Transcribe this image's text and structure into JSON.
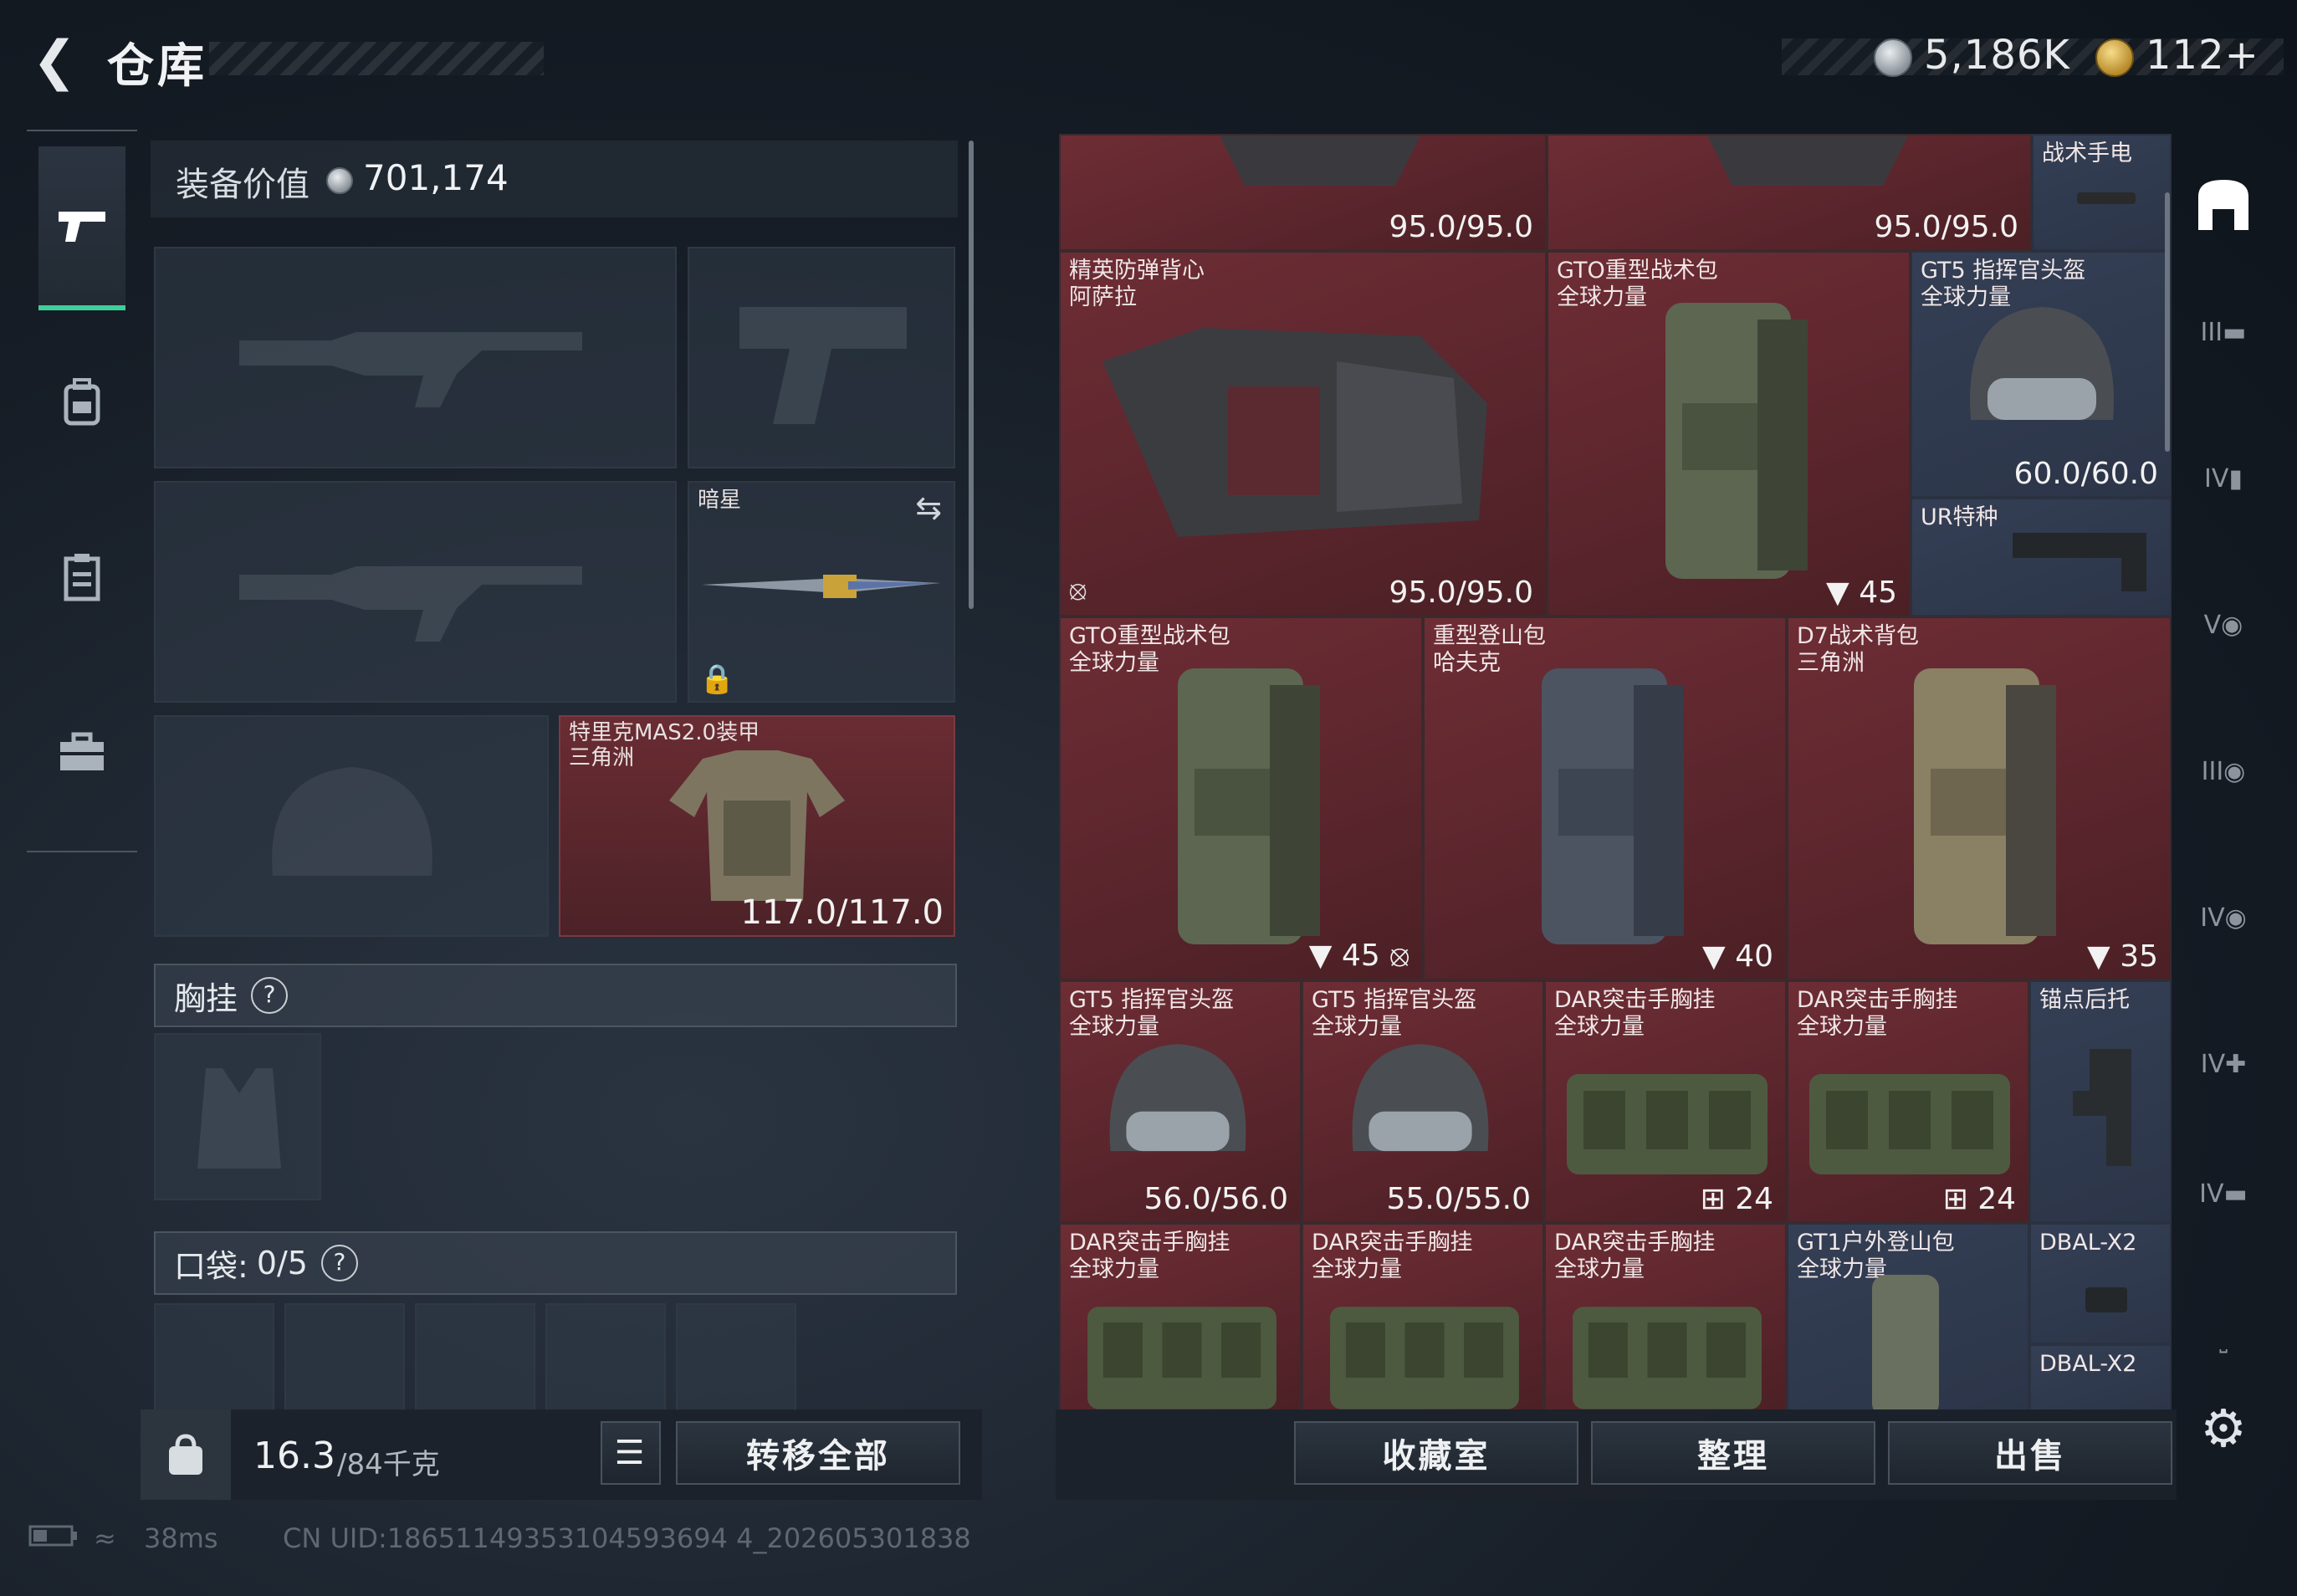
{
  "header": {
    "title": "仓库",
    "currency_silver": "5,186K",
    "currency_gold": "112+"
  },
  "equipment": {
    "value_label": "装备价值",
    "value": "701,174",
    "melee_name": "暗星",
    "armor_name": "特里克MAS2.0装甲",
    "armor_origin": "三角洲",
    "armor_durability": "117.0/117.0",
    "chest_rig_label": "胸挂",
    "chest_rig_help": "?",
    "pockets_label": "口袋:",
    "pockets_count": "0/5",
    "pockets_help": "?",
    "weight_current": "16.3",
    "weight_max": "/84千克",
    "transfer_all": "转移全部"
  },
  "grid": {
    "row0": [
      {
        "dur": "95.0/95.0"
      },
      {
        "dur": "95.0/95.0"
      },
      {
        "name": "战术手电"
      }
    ],
    "items": {
      "vest": {
        "name": "精英防弹背心",
        "sub": "阿萨拉",
        "dur": "95.0/95.0"
      },
      "pack1": {
        "name": "GTO重型战术包",
        "sub": "全球力量",
        "cap": "45"
      },
      "helmet1": {
        "name": "GT5 指挥官头盔",
        "sub": "全球力量",
        "dur": "60.0/60.0"
      },
      "stock1": {
        "name": "UR特种"
      },
      "pack2": {
        "name": "GTO重型战术包",
        "sub": "全球力量",
        "cap": "45"
      },
      "pack3": {
        "name": "重型登山包",
        "sub": "哈夫克",
        "cap": "40"
      },
      "pack4": {
        "name": "D7战术背包",
        "sub": "三角洲",
        "cap": "35"
      },
      "helmet2": {
        "name": "GT5 指挥官头盔",
        "sub": "全球力量",
        "dur": "56.0/56.0"
      },
      "helmet3": {
        "name": "GT5 指挥官头盔",
        "sub": "全球力量",
        "dur": "55.0/55.0"
      },
      "rig1": {
        "name": "DAR突击手胸挂",
        "sub": "全球力量",
        "cap": "24"
      },
      "rig2": {
        "name": "DAR突击手胸挂",
        "sub": "全球力量",
        "cap": "24"
      },
      "stock2": {
        "name": "锚点后托"
      },
      "rig3": {
        "name": "DAR突击手胸挂",
        "sub": "全球力量"
      },
      "rig4": {
        "name": "DAR突击手胸挂",
        "sub": "全球力量"
      },
      "rig5": {
        "name": "DAR突击手胸挂",
        "sub": "全球力量"
      },
      "pack5": {
        "name": "GT1户外登山包",
        "sub": "全球力量"
      },
      "laser1": {
        "name": "DBAL-X2"
      },
      "laser2": {
        "name": "DBAL-X2"
      }
    }
  },
  "bottom_buttons": {
    "collection": "收藏室",
    "sort": "整理",
    "sell": "出售"
  },
  "side_tags": [
    "III",
    "IV",
    "V",
    "III",
    "IV",
    "IV",
    "IV"
  ],
  "status": {
    "ping": "38ms",
    "uid": "CN UID:18651149353104593694 4_202605301838"
  },
  "colors": {
    "accent_green": "#3ecf9a",
    "cell_red": "#6e2d35",
    "cell_blue": "#343f55"
  }
}
